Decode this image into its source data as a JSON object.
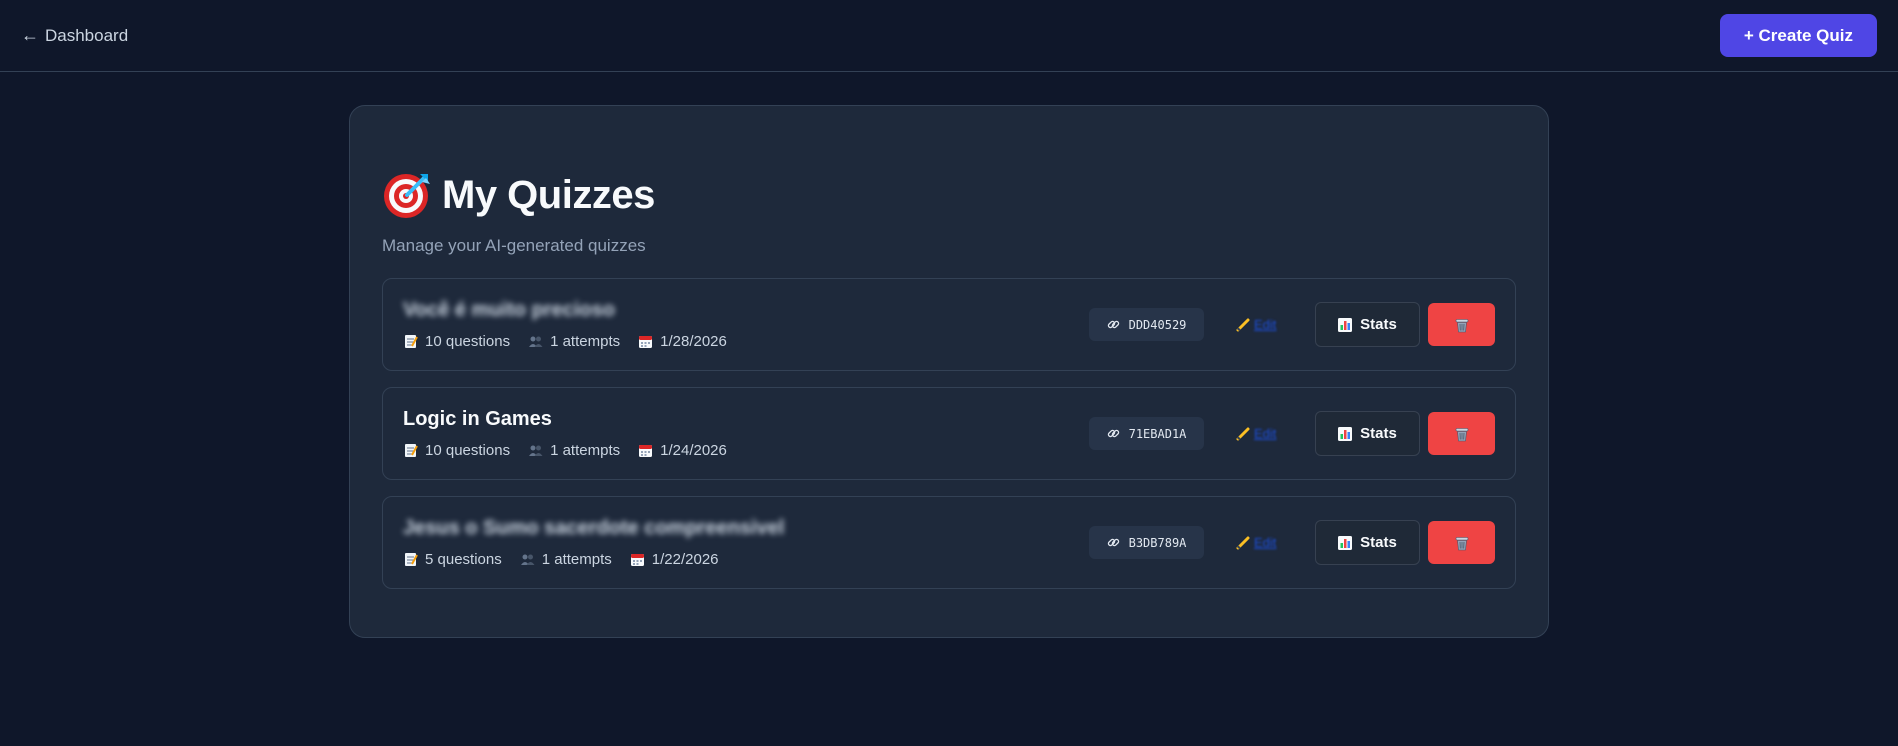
{
  "header": {
    "back_arrow": "←",
    "back_label": "Dashboard",
    "create_label": "+ Create Quiz"
  },
  "page": {
    "title": "My Quizzes",
    "subtitle": "Manage your AI-generated quizzes"
  },
  "actions": {
    "edit_label": "Edit",
    "stats_label": "Stats"
  },
  "quizzes": [
    {
      "title": "Você é muito precioso",
      "blurred": true,
      "questions": "10 questions",
      "attempts": "1 attempts",
      "date": "1/28/2026",
      "code": "DDD40529"
    },
    {
      "title": "Logic in Games",
      "blurred": false,
      "questions": "10 questions",
      "attempts": "1 attempts",
      "date": "1/24/2026",
      "code": "71EBAD1A"
    },
    {
      "title": "Jesus o Sumo sacerdote compreensivel",
      "blurred": true,
      "questions": "5 questions",
      "attempts": "1 attempts",
      "date": "1/22/2026",
      "code": "B3DB789A"
    }
  ],
  "colors": {
    "background": "#0f172a",
    "panel": "#1e293b",
    "accent": "#4f46e5",
    "danger": "#ef4444",
    "edit_link": "#1d4ed8"
  },
  "icons": {
    "title": "target-dart-icon",
    "questions": "memo-icon",
    "attempts": "people-icon",
    "date": "calendar-icon",
    "code": "link-icon",
    "edit": "pencil-icon",
    "stats": "bar-chart-icon",
    "delete": "trash-icon"
  }
}
